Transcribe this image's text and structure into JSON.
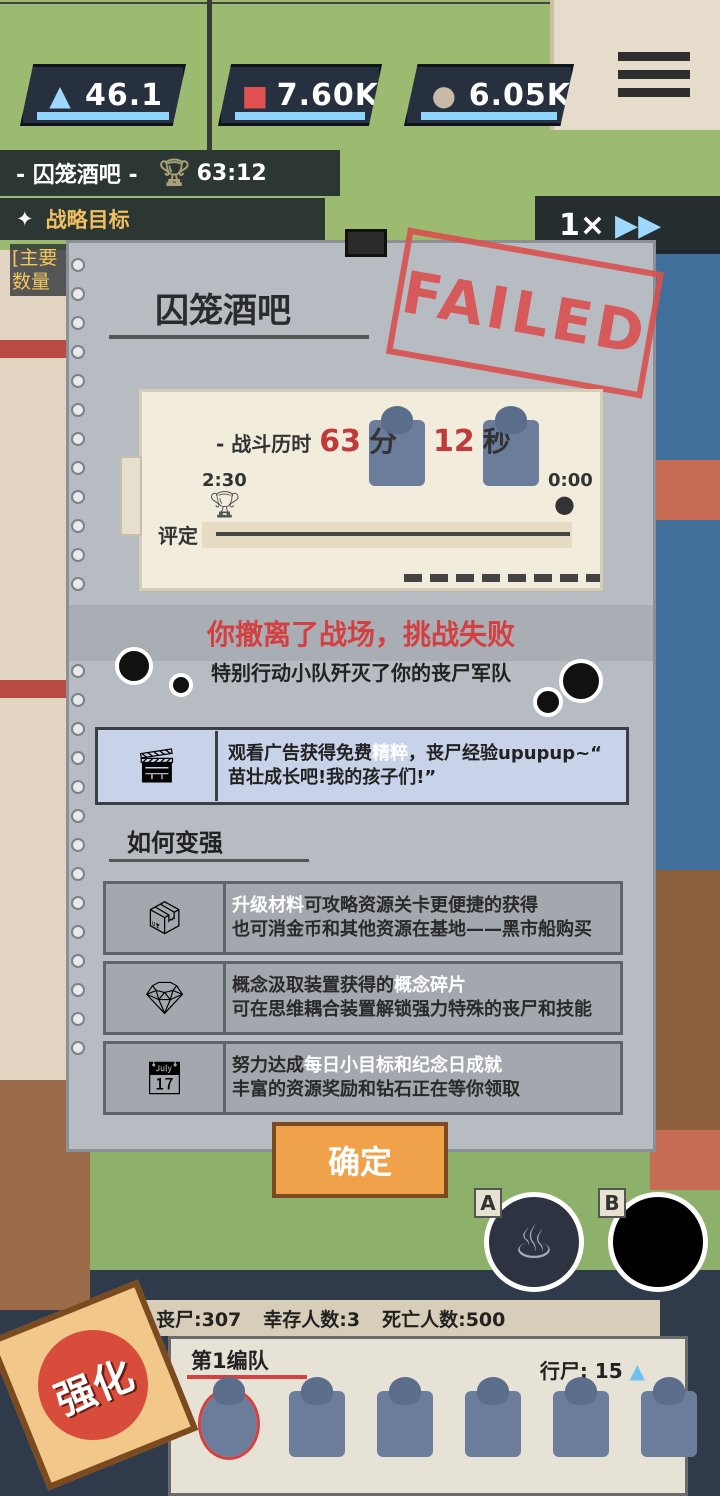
{
  "resources": [
    {
      "icon": "crystal-icon",
      "value": "46.1"
    },
    {
      "icon": "materials-icon",
      "value": "7.60K"
    },
    {
      "icon": "ore-icon",
      "value": "6.05K"
    }
  ],
  "stage": {
    "name": "- 囚笼酒吧 -",
    "time": "63:12",
    "objective": "战略目标",
    "main_objective": "[主要数量"
  },
  "speed": {
    "label": "1×"
  },
  "dialog": {
    "title": "囚笼酒吧",
    "stamp": "FAILED",
    "duration_label": "- 战斗历时",
    "duration_min": "63",
    "min_unit": "分",
    "duration_sec": "12",
    "sec_unit": "秒",
    "timeline_start": "2:30",
    "timeline_end": "0:00",
    "rating_label": "评定",
    "fail_title": "你撤离了战场，挑战失败",
    "fail_sub": "特别行动小队歼灭了你的丧尸军队",
    "ad_line1_a": "观看广告获得免费",
    "ad_line1_hl": "精粹",
    "ad_line1_b": "，丧尸经验upupup~“",
    "ad_line2": "苗壮成长吧!我的孩子们!”",
    "howto_title": "如何变强",
    "tips": [
      {
        "hl": "升级材料",
        "line1_rest": "可攻略资源关卡更便捷的获得",
        "line2": "也可消金币和其他资源在基地——黑市船购买"
      },
      {
        "pre": "概念汲取装置获得的",
        "hl": "概念碎片",
        "line2": "可在思维耦合装置解锁强力特殊的丧尸和技能"
      },
      {
        "pre": "努力达成",
        "hl": "每日小目标和纪念日成就",
        "line2": "丰富的资源奖励和钻石正在等你领取"
      }
    ],
    "confirm_label": "确定"
  },
  "hud": {
    "skill_a_label": "A",
    "skill_b_label": "B",
    "zombies": "丧尸:307",
    "survivors": "幸存人数:3",
    "deaths": "死亡人数:500",
    "team_name": "第1编队",
    "walkers": "行尸: 15",
    "upgrade_label": "强化"
  }
}
